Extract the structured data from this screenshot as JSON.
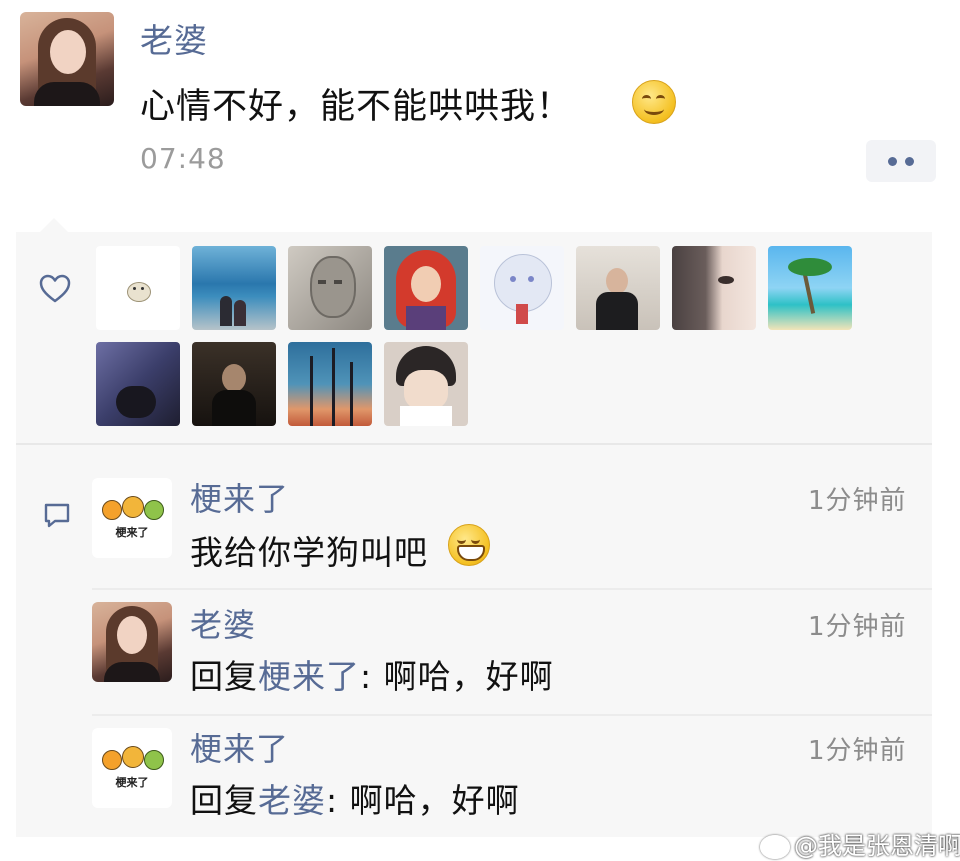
{
  "post": {
    "author": "老婆",
    "text": "心情不好，能不能哄哄我！",
    "time": "07:48",
    "emoji": "smile-emoji"
  },
  "likes": {
    "icon": "heart-icon",
    "avatars": [
      {
        "name": "liker-avatar-cartoon-dog"
      },
      {
        "name": "liker-avatar-beach-couple"
      },
      {
        "name": "liker-avatar-statue"
      },
      {
        "name": "liker-avatar-redhead-cartoon"
      },
      {
        "name": "liker-avatar-anime-white-hair"
      },
      {
        "name": "liker-avatar-man-room"
      },
      {
        "name": "liker-avatar-woman-closeup"
      },
      {
        "name": "liker-avatar-palm-beach"
      },
      {
        "name": "liker-avatar-dark-room"
      },
      {
        "name": "liker-avatar-man-dark"
      },
      {
        "name": "liker-avatar-palm-sunset"
      },
      {
        "name": "liker-avatar-anime-man"
      }
    ]
  },
  "comments": {
    "icon": "comment-icon",
    "items": [
      {
        "author": "梗来了",
        "time": "1分钟前",
        "text": "我给你学狗叫吧",
        "emoji": "grin-emoji"
      },
      {
        "author": "老婆",
        "time": "1分钟前",
        "reply_prefix": "回复",
        "reply_to": "梗来了",
        "text": ": 啊哈，好啊"
      },
      {
        "author": "梗来了",
        "time": "1分钟前",
        "reply_prefix": "回复",
        "reply_to": "老婆",
        "text": ": 啊哈，好啊"
      }
    ]
  },
  "logo_text": "梗来了",
  "watermark": "@我是张恩清啊",
  "colors": {
    "name_blue": "#576b95",
    "panel_bg": "#f7f7f7",
    "time_gray": "#9b9b9b"
  }
}
